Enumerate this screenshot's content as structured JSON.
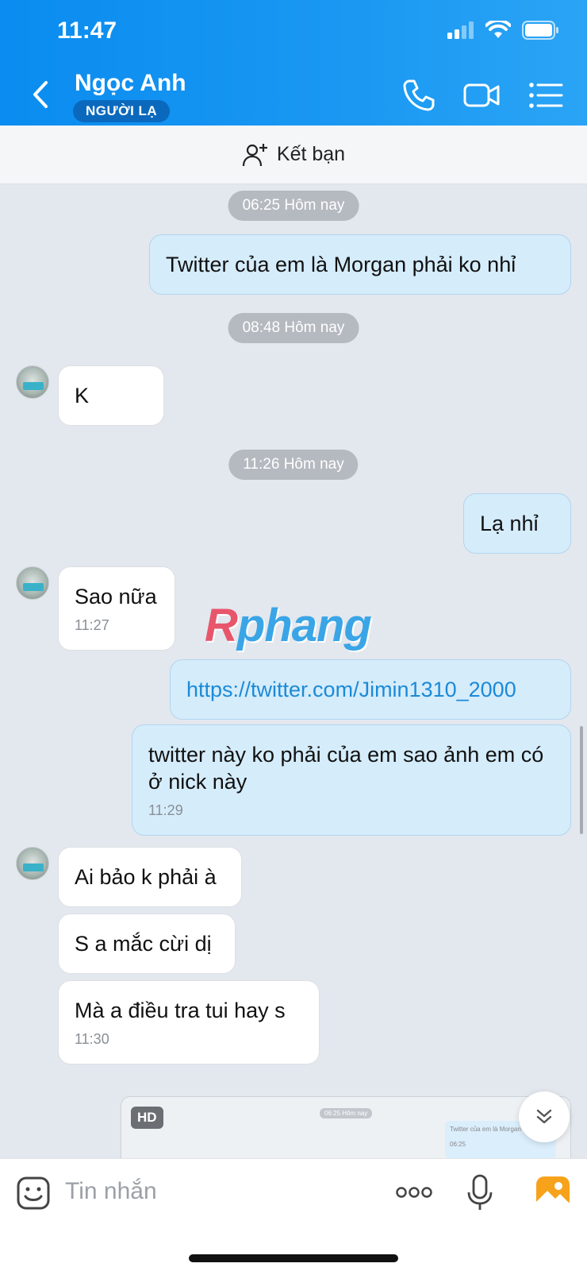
{
  "status_bar": {
    "time": "11:47"
  },
  "header": {
    "contact_name": "Ngọc Anh",
    "badge": "NGƯỜI LẠ",
    "icons": [
      "back-chevron-icon",
      "phone-icon",
      "video-call-icon",
      "menu-list-icon"
    ]
  },
  "friend_bar": {
    "label": "Kết bạn",
    "icon": "add-friend-icon"
  },
  "messages": {
    "sep1": "06:25 Hôm nay",
    "m1": "Twitter của em là Morgan phải ko nhỉ",
    "sep2": "08:48 Hôm nay",
    "m2": "K",
    "sep3": "11:26 Hôm nay",
    "m3": "Lạ nhỉ",
    "m4": "Sao nữa",
    "m4_time": "11:27",
    "m5": "https://twitter.com/Jimin1310_2000",
    "m6": "twitter này ko phải của em sao ảnh em có ở nick này",
    "m6_time": "11:29",
    "m7": "Ai bảo k phải à",
    "m8": "S a mắc cừi dị",
    "m9": "Mà a điều tra tui hay s",
    "m9_time": "11:30"
  },
  "watermark": {
    "initial": "R",
    "rest": "phang"
  },
  "image_preview": {
    "badge": "HD",
    "mini_sep": "06:25 Hôm nay",
    "mini_text": "Twitter của em là Morgan",
    "mini_time": "06:25"
  },
  "input_bar": {
    "placeholder": "Tin nhắn"
  },
  "colors": {
    "header": "#0a8cf0",
    "outgoing_bubble": "#d5ecfb",
    "incoming_bubble": "#ffffff",
    "background": "#e3e7ee"
  }
}
